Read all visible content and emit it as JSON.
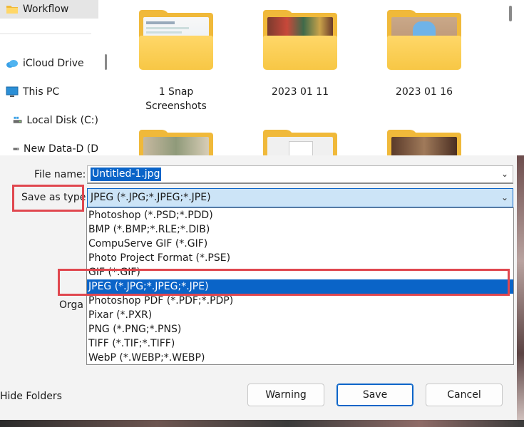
{
  "nav": {
    "items": [
      {
        "label": "Workflow",
        "icon": "folder-icon"
      },
      {
        "label": "iCloud Drive",
        "icon": "cloud-icon"
      },
      {
        "label": "This PC",
        "icon": "monitor-icon"
      },
      {
        "label": "Local Disk (C:)",
        "icon": "drive-icon"
      },
      {
        "label": "New Data-D (D",
        "icon": "drive-icon"
      }
    ]
  },
  "folders": [
    {
      "label_line1": "1 Snap",
      "label_line2": "Screenshots"
    },
    {
      "label_line1": "2023 01 11",
      "label_line2": ""
    },
    {
      "label_line1": "2023 01 16",
      "label_line2": ""
    }
  ],
  "form": {
    "file_name_label": "File name:",
    "file_name_value": "Untitled-1.jpg",
    "save_as_type_label": "Save as type:",
    "save_as_type_value": "JPEG (*.JPG;*.JPEG;*.JPE)",
    "organize_partial": "Orga"
  },
  "dropdown": {
    "options": [
      "Photoshop (*.PSD;*.PDD)",
      "BMP (*.BMP;*.RLE;*.DIB)",
      "CompuServe GIF (*.GIF)",
      "Photo Project Format (*.PSE)",
      "GIF (*.GIF)",
      "JPEG (*.JPG;*.JPEG;*.JPE)",
      "Photoshop PDF (*.PDF;*.PDP)",
      "Pixar (*.PXR)",
      "PNG (*.PNG;*.PNS)",
      "TIFF (*.TIF;*.TIFF)",
      "WebP (*.WEBP;*.WEBP)"
    ],
    "selected": "JPEG (*.JPG;*.JPEG;*.JPE)"
  },
  "footer": {
    "hide_folders_label": "Hide Folders",
    "warning_label": "Warning",
    "save_label": "Save",
    "cancel_label": "Cancel"
  },
  "colors": {
    "accent": "#0a64c8",
    "highlight_box": "#e0474f",
    "folder": "#f7c745"
  }
}
